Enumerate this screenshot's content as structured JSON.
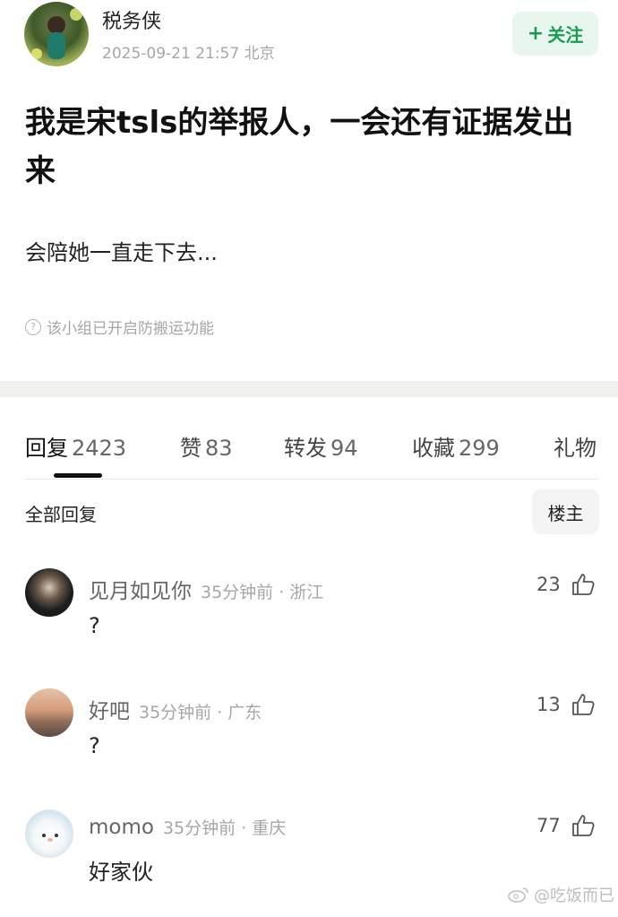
{
  "post": {
    "author_name": "税务侠",
    "meta": "2025-09-21 21:57  北京",
    "follow_label": "关注",
    "title": "我是宋tsls的举报人，一会还有证据发出来",
    "body": "会陪她一直走下去...",
    "notice": "该小组已开启防搬运功能"
  },
  "tabs": [
    {
      "label": "回复",
      "count": "2423",
      "active": true
    },
    {
      "label": "赞",
      "count": "83"
    },
    {
      "label": "转发",
      "count": "94"
    },
    {
      "label": "收藏",
      "count": "299"
    },
    {
      "label": "礼物",
      "count": ""
    }
  ],
  "replies_header": {
    "all_label": "全部回复",
    "owner_label": "楼主"
  },
  "comments": [
    {
      "name": "见月如见你",
      "meta": "35分钟前 · 浙江",
      "likes": "23",
      "text": "?"
    },
    {
      "name": "好吧",
      "meta": "35分钟前 · 广东",
      "likes": "13",
      "text": "?"
    },
    {
      "name": "momo",
      "meta": "35分钟前 · 重庆",
      "likes": "77",
      "text": "好家伙"
    }
  ],
  "watermark": "@吃饭而已",
  "colors": {
    "accent": "#1a9b54",
    "follow_bg": "#e9f6ee"
  },
  "icons": {
    "like": "thumbs-up-icon",
    "notice": "question-circle-icon",
    "weibo": "weibo-icon"
  }
}
